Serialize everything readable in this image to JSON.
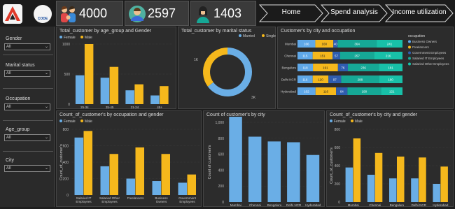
{
  "header": {
    "kpis": [
      {
        "value": "4000",
        "icon": "family-icon"
      },
      {
        "value": "2597",
        "icon": "married-person-icon"
      },
      {
        "value": "1403",
        "icon": "single-person-icon"
      }
    ],
    "logo2_text": "CODE BASICS",
    "nav": [
      "Home",
      "Spend analysis",
      "Income utilization"
    ]
  },
  "sidebar": {
    "filters": [
      {
        "label": "Gender",
        "value": "All"
      },
      {
        "label": "Marital status",
        "value": "All"
      },
      {
        "label": "Occupation",
        "value": "All"
      },
      {
        "label": "Age_group",
        "value": "All"
      },
      {
        "label": "City",
        "value": "All"
      }
    ]
  },
  "colors": {
    "female": "#6aaee6",
    "male": "#f5b81c",
    "occ": [
      "#5fa8e8",
      "#f5b81c",
      "#2f5db0",
      "#16a896",
      "#18c0a8"
    ]
  },
  "chart_data": [
    {
      "type": "bar",
      "title": "Total_customer by age_group and Gender",
      "legend": [
        "Female",
        "Male"
      ],
      "categories": [
        "25-34",
        "35-45",
        "21-24",
        "45+"
      ],
      "series": [
        {
          "name": "Female",
          "values": [
            480,
            440,
            230,
            145
          ]
        },
        {
          "name": "Male",
          "values": [
            1000,
            620,
            330,
            300
          ]
        }
      ],
      "ylim": [
        0,
        1000
      ],
      "yticks": [
        "0",
        "500",
        "1000"
      ]
    },
    {
      "type": "pie",
      "title": "Total_customer by marital status",
      "legend": [
        "Married",
        "Single"
      ],
      "values": [
        2597,
        1403
      ],
      "labels": [
        "1K",
        "3K"
      ]
    },
    {
      "type": "bar",
      "title": "Customer's by city and occupation",
      "categories": [
        "Mumbai",
        "Chennai",
        "Bengaluru",
        "Delhi NCR",
        "Hyderabad"
      ],
      "legend_title": "occupation",
      "legend": [
        "Business Owners",
        "Freelancers",
        "Government Employees",
        "Salaried IT Employees",
        "Salaried Other Employees"
      ],
      "series": [
        {
          "name": "Business Owners",
          "values": [
            166,
            115,
            118,
            116,
            102
          ]
        },
        {
          "name": "Freelancers",
          "values": [
            168,
            151,
            191,
            120,
            116
          ]
        },
        {
          "name": "Government Employees",
          "values": [
            40,
            57,
            76,
            97,
            64
          ]
        },
        {
          "name": "Salaried IT Employees",
          "values": [
            364,
            257,
            236,
            288,
            190
          ]
        },
        {
          "name": "Salaried Other Employees",
          "values": [
            241,
            216,
            181,
            180,
            121
          ]
        }
      ]
    },
    {
      "type": "bar",
      "title": "Count_of_customer's by occupation and gender",
      "legend": [
        "Female",
        "Male"
      ],
      "ylabel": "Count_of_customer's",
      "categories": [
        "Salaried IT Employees",
        "Salaried Other Employees",
        "Freelancers",
        "Business Owners",
        "Government Employees"
      ],
      "series": [
        {
          "name": "Female",
          "values": [
            700,
            350,
            200,
            170,
            150
          ]
        },
        {
          "name": "Male",
          "values": [
            780,
            500,
            580,
            500,
            250
          ]
        }
      ],
      "ylim": [
        0,
        800
      ],
      "yticks": [
        "0",
        "200",
        "400",
        "600",
        "800"
      ]
    },
    {
      "type": "bar",
      "title": "Count of customer's by city",
      "ylabel": "Count of customer's",
      "categories": [
        "Mumbai",
        "Chennai",
        "Bengaluru",
        "Delhi NCR",
        "Hyderabad"
      ],
      "values": [
        1070,
        820,
        760,
        750,
        590
      ],
      "ylim": [
        0,
        1000
      ],
      "yticks": [
        "0",
        "200",
        "400",
        "600",
        "800",
        "1,000"
      ]
    },
    {
      "type": "bar",
      "title": "Count_of_customer's by city and gender",
      "legend": [
        "Female",
        "Male"
      ],
      "ylabel": "Count_of_customer's",
      "categories": [
        "Mumbai",
        "Chennai",
        "Bengaluru",
        "Delhi NCR",
        "Hyderabad"
      ],
      "series": [
        {
          "name": "Female",
          "values": [
            380,
            300,
            260,
            260,
            200
          ]
        },
        {
          "name": "Male",
          "values": [
            700,
            540,
            500,
            490,
            390
          ]
        }
      ],
      "ylim": [
        0,
        800
      ],
      "yticks": [
        "0",
        "200",
        "400",
        "600",
        "800"
      ]
    }
  ]
}
